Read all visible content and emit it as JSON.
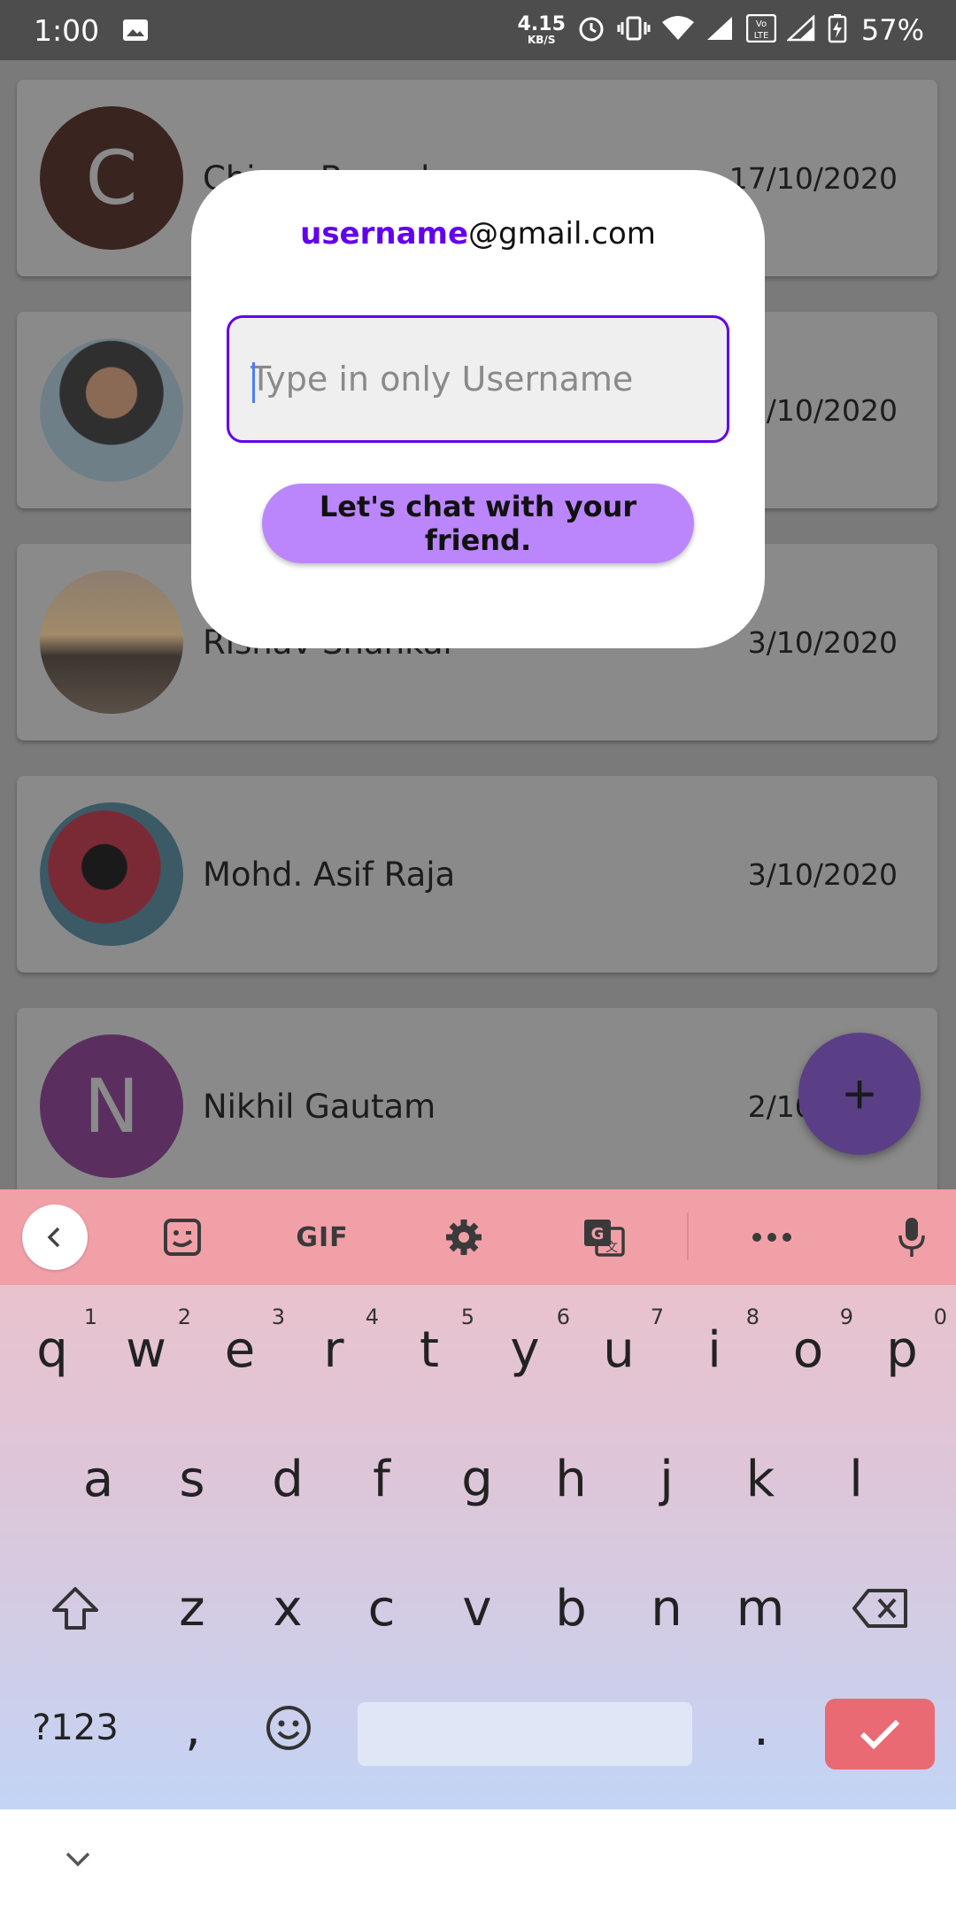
{
  "status_bar": {
    "time": "1:00",
    "speed_value": "4.15",
    "speed_unit": "KB/S",
    "battery": "57%"
  },
  "contacts": [
    {
      "name": "Chirag Bansal",
      "date": "17/10/2020",
      "initial": "C",
      "avatar_color": "#3a2420"
    },
    {
      "name": "",
      "date": "17/10/2020",
      "initial": "",
      "avatar_color": "#5b5a57"
    },
    {
      "name": "Rishav Shankar",
      "date": "3/10/2020",
      "initial": "",
      "avatar_color": "#6b5b4d"
    },
    {
      "name": "Mohd. Asif Raja",
      "date": "3/10/2020",
      "initial": "",
      "avatar_color": "#5a3a3e"
    },
    {
      "name": "Nikhil Gautam",
      "date": "2/10/2020",
      "initial": "N",
      "avatar_color": "#5a2f5f"
    }
  ],
  "fab": {
    "label": "+"
  },
  "dialog": {
    "email_username": "username",
    "email_domain": "@gmail.com",
    "input_placeholder": "Type in only Username",
    "input_value": "",
    "button_label": "Let's chat with your friend."
  },
  "keyboard": {
    "toolbar": {
      "gif_label": "GIF"
    },
    "row1": [
      {
        "key": "q",
        "hint": "1"
      },
      {
        "key": "w",
        "hint": "2"
      },
      {
        "key": "e",
        "hint": "3"
      },
      {
        "key": "r",
        "hint": "4"
      },
      {
        "key": "t",
        "hint": "5"
      },
      {
        "key": "y",
        "hint": "6"
      },
      {
        "key": "u",
        "hint": "7"
      },
      {
        "key": "i",
        "hint": "8"
      },
      {
        "key": "o",
        "hint": "9"
      },
      {
        "key": "p",
        "hint": "0"
      }
    ],
    "row2": [
      "a",
      "s",
      "d",
      "f",
      "g",
      "h",
      "j",
      "k",
      "l"
    ],
    "row3": [
      "z",
      "x",
      "c",
      "v",
      "b",
      "n",
      "m"
    ],
    "symbols_label": "?123",
    "comma": ",",
    "period": "."
  },
  "colors": {
    "accent": "#6200ee",
    "button": "#bb86fc",
    "enter_key": "#ea6a74",
    "keyboard_toolbar": "#f2a0a8"
  }
}
